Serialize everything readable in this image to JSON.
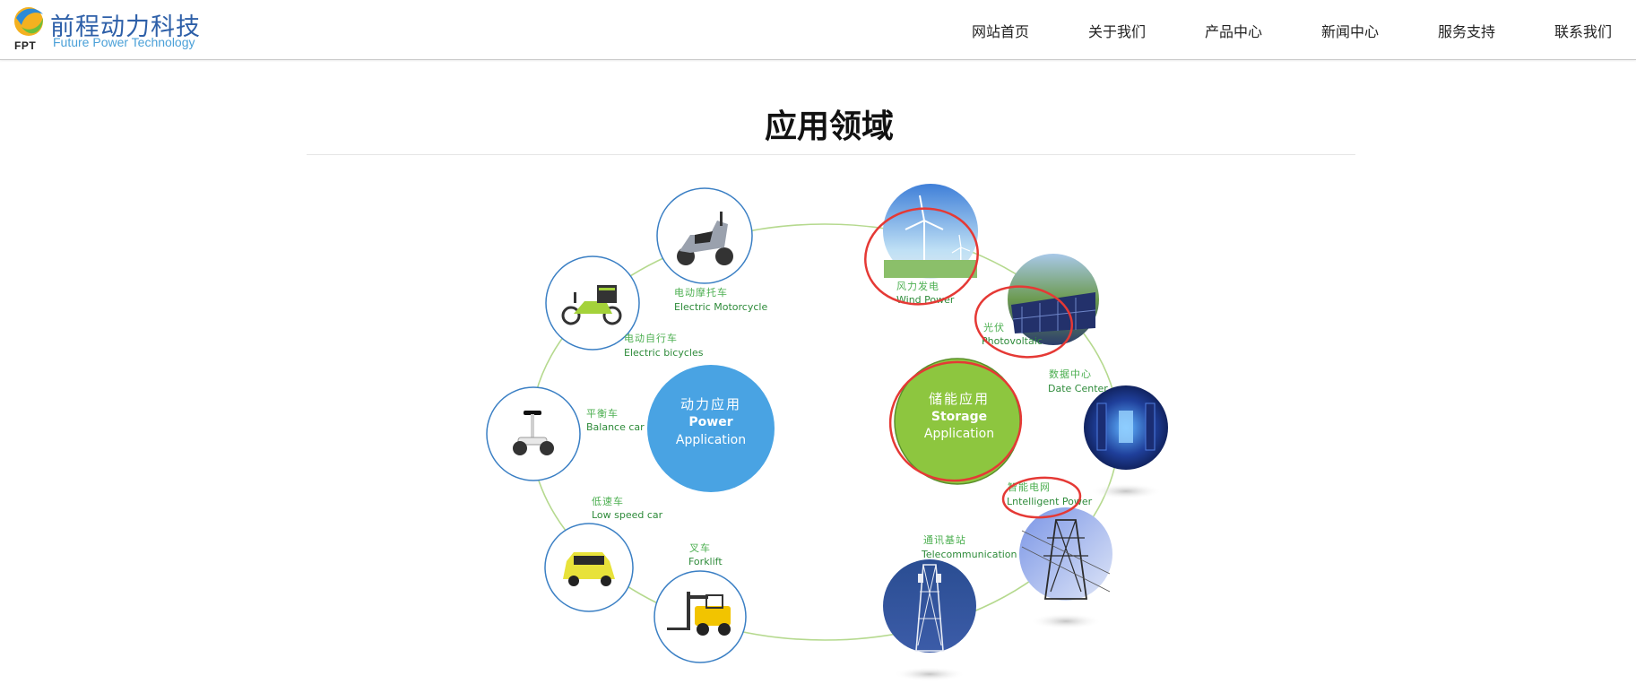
{
  "brand": {
    "name_cn": "前程动力科技",
    "name_en": "Future Power Technology",
    "abbr": "FPT"
  },
  "nav": {
    "items": [
      {
        "label": "网站首页"
      },
      {
        "label": "关于我们"
      },
      {
        "label": "产品中心"
      },
      {
        "label": "新闻中心"
      },
      {
        "label": "服务支持"
      },
      {
        "label": "联系我们"
      }
    ]
  },
  "section": {
    "title": "应用领域"
  },
  "diagram": {
    "power_center": {
      "cn": "动力应用",
      "en1": "Power",
      "en2": "Application"
    },
    "storage_center": {
      "cn": "储能应用",
      "en1": "Storage",
      "en2": "Application"
    },
    "power_items": [
      {
        "cn": "电动摩托车",
        "en": "Electric Motorcycle",
        "icon": "motorcycle-icon"
      },
      {
        "cn": "电动自行车",
        "en": "Electric bicycles",
        "icon": "bicycle-icon"
      },
      {
        "cn": "平衡车",
        "en": "Balance car",
        "icon": "balance-car-icon"
      },
      {
        "cn": "低速车",
        "en": "Low speed car",
        "icon": "car-icon"
      },
      {
        "cn": "叉车",
        "en": "Forklift",
        "icon": "forklift-icon"
      }
    ],
    "storage_items": [
      {
        "cn": "风力发电",
        "en": "Wind Power",
        "icon": "wind-turbine-icon"
      },
      {
        "cn": "光伏",
        "en": "Photovoltaic",
        "icon": "solar-panel-icon"
      },
      {
        "cn": "数据中心",
        "en": "Date Center",
        "icon": "server-room-icon"
      },
      {
        "cn": "智能电网",
        "en": "Lntelligent Power",
        "icon": "power-tower-icon"
      },
      {
        "cn": "通讯基站",
        "en": "Telecommunication",
        "icon": "cell-tower-icon"
      }
    ],
    "colors": {
      "power": "#49a3e3",
      "storage": "#8dc63f",
      "ring": "#b5d98e",
      "label": "#4caf50",
      "annotation": "#e53935",
      "brand": "#2d5fa8"
    }
  }
}
